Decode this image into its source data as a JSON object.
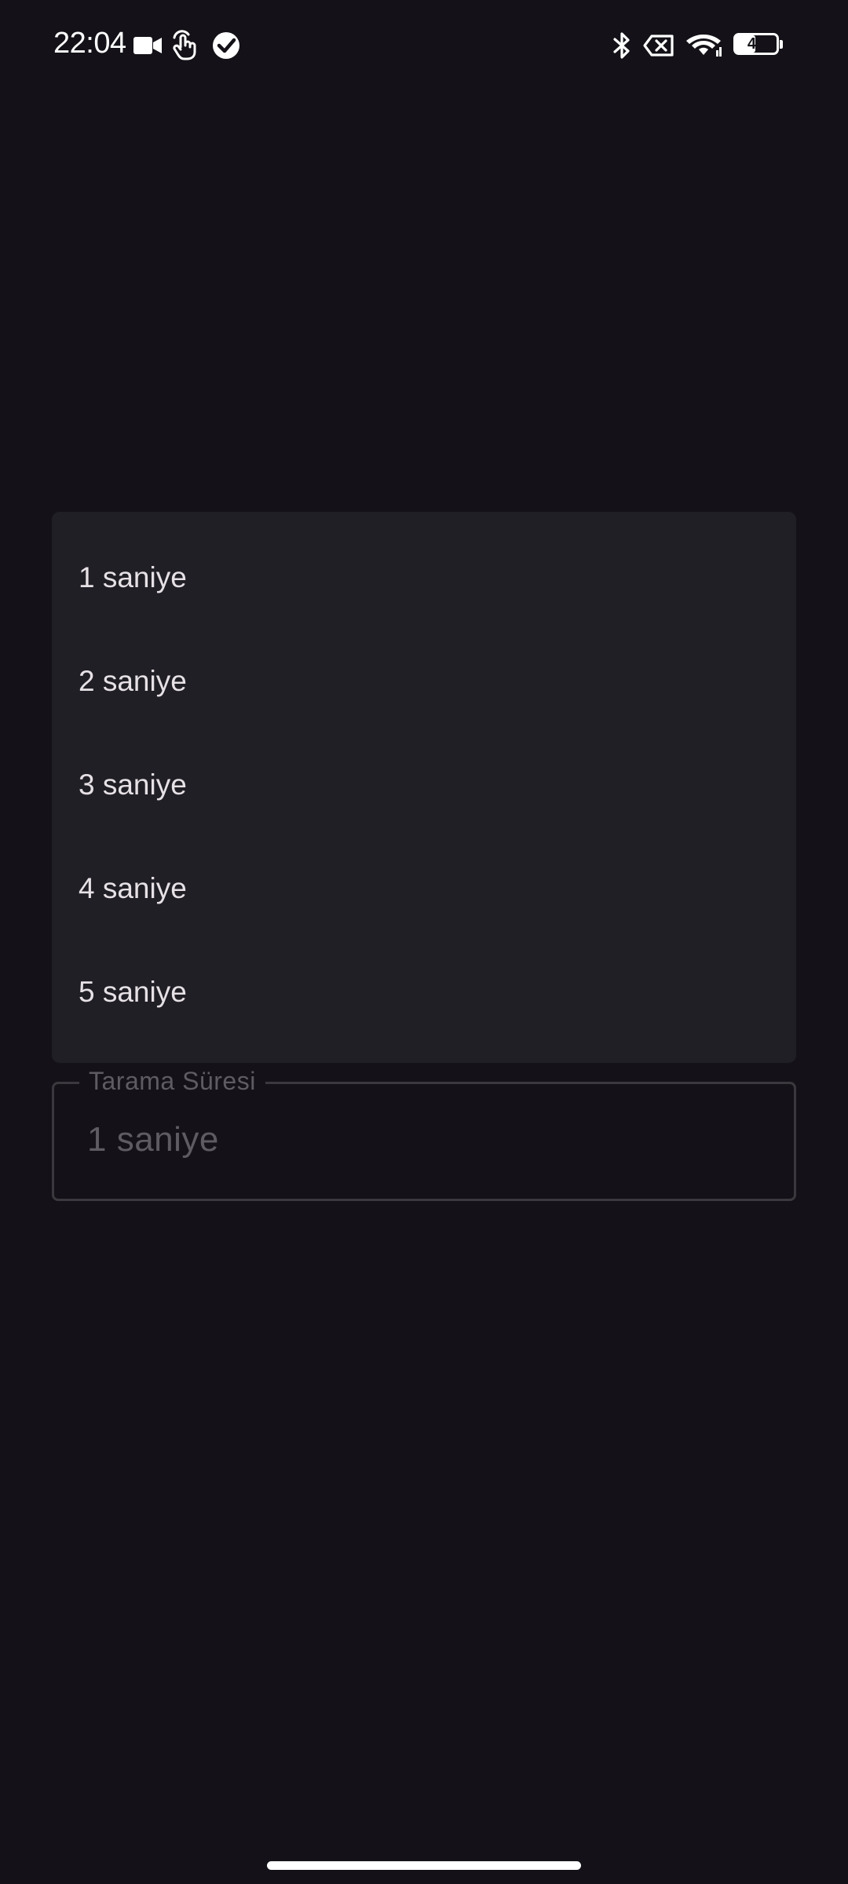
{
  "status_bar": {
    "time": "22:04",
    "icons_left": [
      "video-camera-icon",
      "touch-gesture-icon",
      "check-badge-icon"
    ],
    "icons_right": [
      "bluetooth-icon",
      "no-sim-icon",
      "wifi-icon",
      "battery-icon"
    ],
    "battery_level": "49",
    "battery_fraction": 0.49
  },
  "dropdown": {
    "items": [
      {
        "label": "1 saniye"
      },
      {
        "label": "2 saniye"
      },
      {
        "label": "3 saniye"
      },
      {
        "label": "4 saniye"
      },
      {
        "label": "5 saniye"
      }
    ]
  },
  "scan_duration_field": {
    "label": "Tarama Süresi",
    "value": "1 saniye"
  },
  "colors": {
    "background": "#141218",
    "menu_surface": "#211f26",
    "text_primary": "#e6e1e5",
    "text_disabled": "#5f5b63",
    "outline": "#3b383e"
  }
}
